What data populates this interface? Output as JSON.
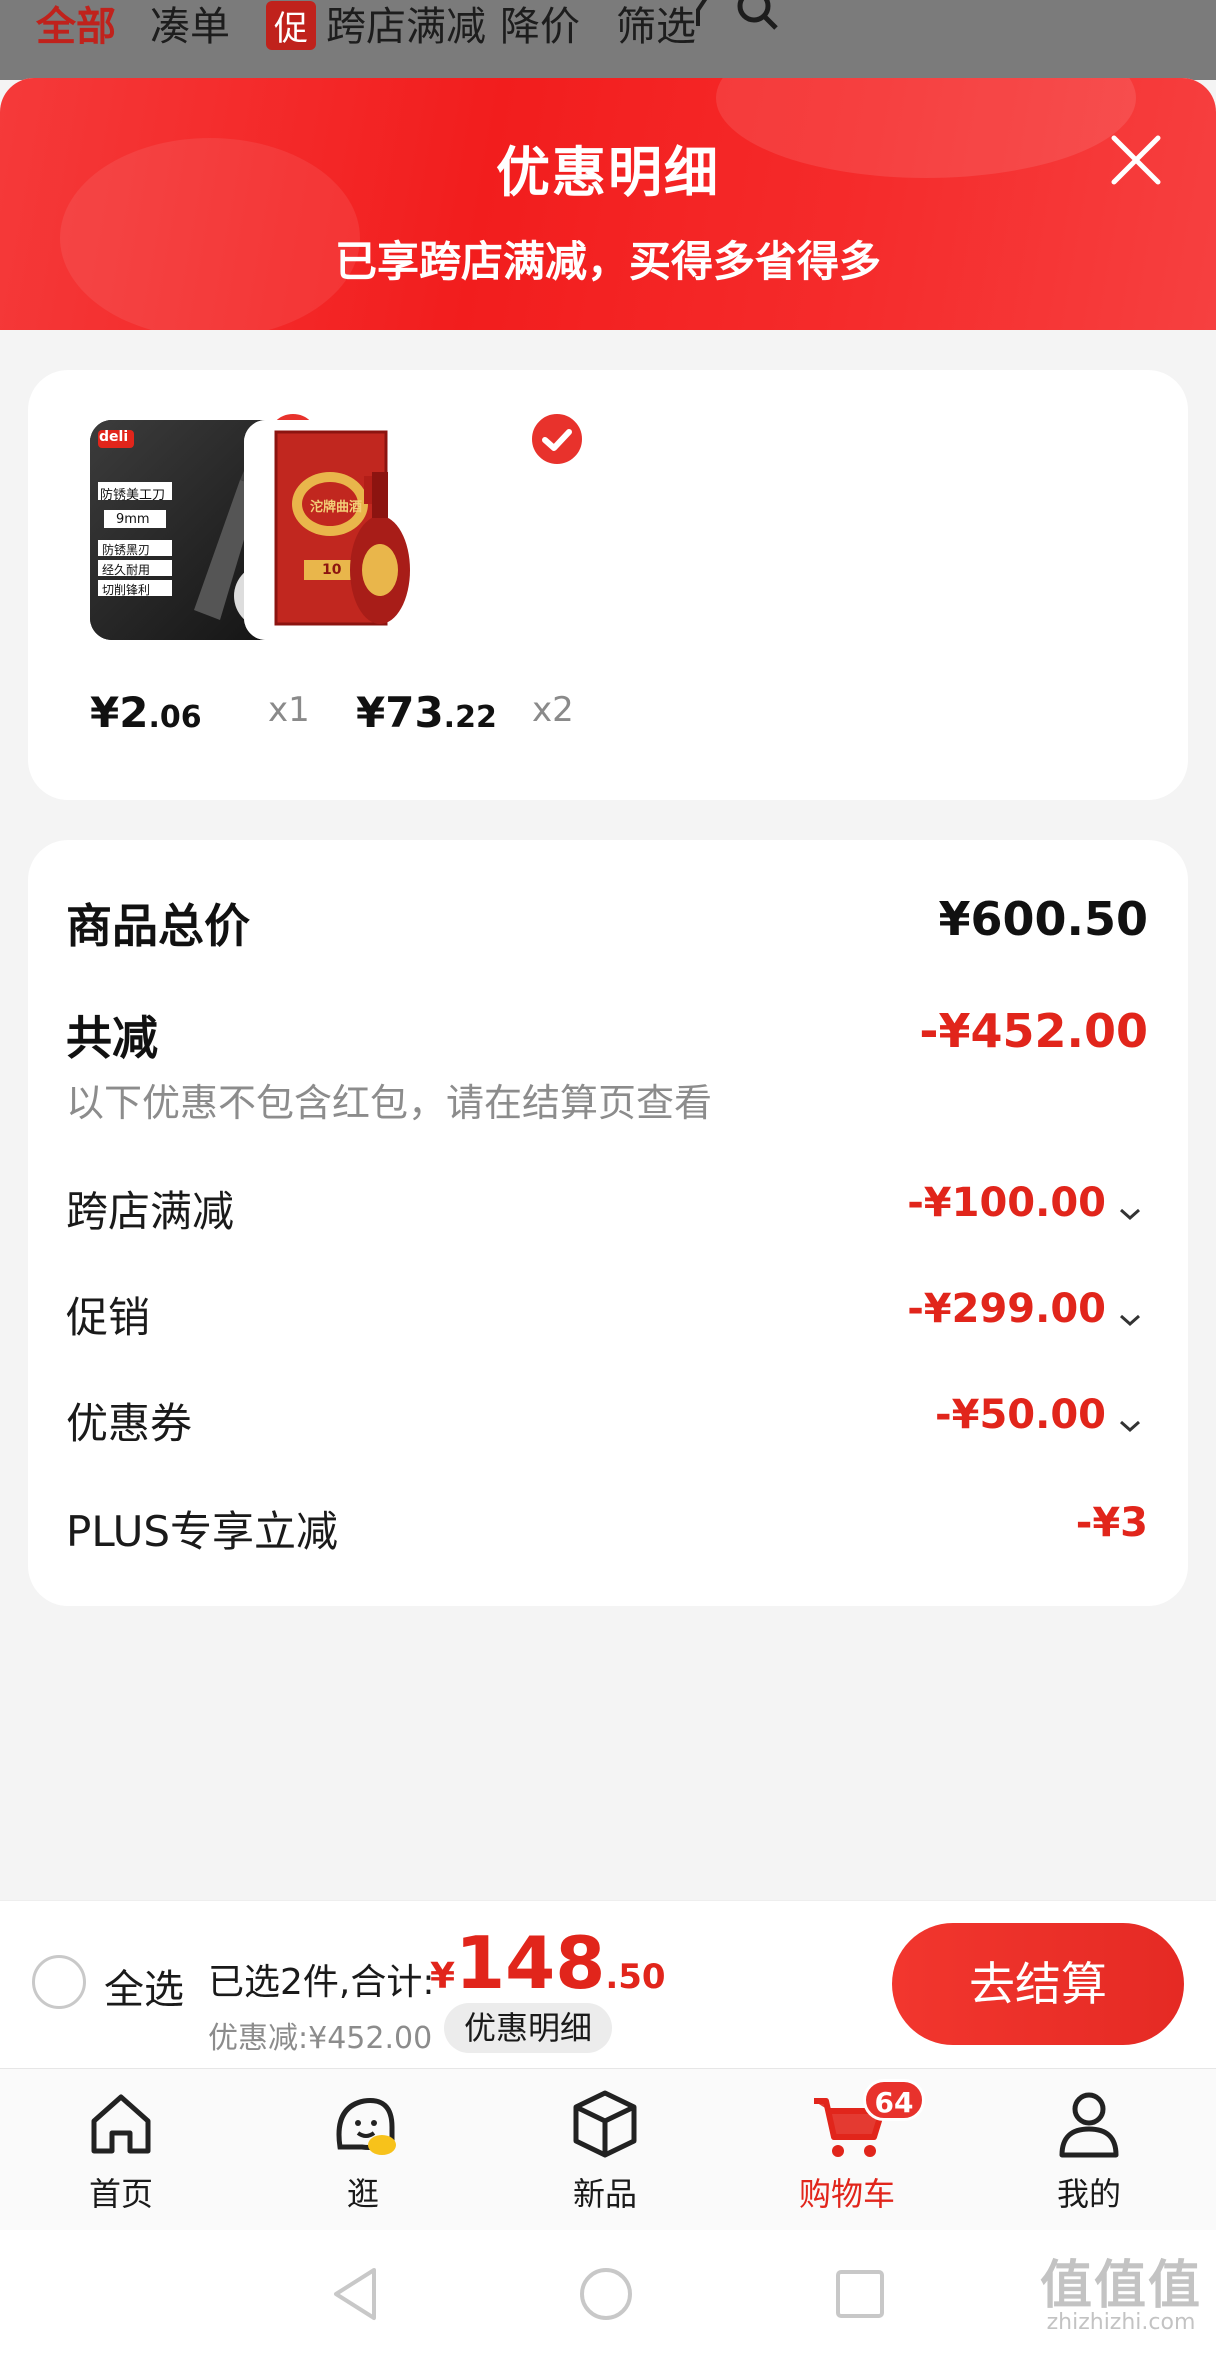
{
  "topbar": {
    "tabs": [
      "全部",
      "凑单",
      "跨店满减",
      "降价",
      "筛选"
    ],
    "promo_tag": "促"
  },
  "sheet": {
    "title": "优惠明细",
    "subtitle": "已享跨店满减，买得多省得多"
  },
  "products": [
    {
      "price_int": "¥2",
      "price_dec": ".06",
      "qty": "x1"
    },
    {
      "price_int": "¥73",
      "price_dec": ".22",
      "qty": "x2"
    }
  ],
  "product_images": {
    "knife_brand": "deli",
    "knife_label": "防锈美工刀",
    "knife_spec": "9mm",
    "knife_features": [
      "防锈黑刃",
      "经久耐用",
      "切削锋利"
    ],
    "liquor_name": "沱牌曲酒",
    "liquor_age": "10"
  },
  "summary": {
    "total_label": "商品总价",
    "total_value": "¥600.50",
    "reduction_label": "共减",
    "reduction_value": "-¥452.00",
    "note": "以下优惠不包含红包，请在结算页查看",
    "items": [
      {
        "label": "跨店满减",
        "value": "-¥100.00"
      },
      {
        "label": "促销",
        "value": "-¥299.00"
      },
      {
        "label": "优惠券",
        "value": "-¥50.00"
      },
      {
        "label": "PLUS专享立减",
        "value": "-¥3"
      }
    ]
  },
  "checkout": {
    "select_all": "全选",
    "selected_text": "已选2件,合计:",
    "total_yen": "¥",
    "total_int": "148",
    "total_dec": ".50",
    "discount_text": "优惠减:¥452.00",
    "detail_chip": "优惠明细",
    "button": "去结算"
  },
  "bottom_nav": {
    "items": [
      "首页",
      "逛",
      "新品",
      "购物车",
      "我的"
    ],
    "cart_badge": "64"
  },
  "watermark": {
    "text": "值值值",
    "domain": "zhizhizhi.com"
  },
  "colors": {
    "accent": "#e1251b",
    "header_red": "#f21d1d"
  }
}
